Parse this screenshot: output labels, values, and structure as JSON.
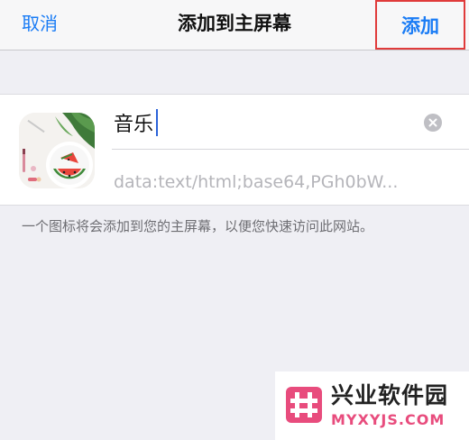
{
  "navbar": {
    "cancel_label": "取消",
    "title": "添加到主屏幕",
    "add_label": "添加"
  },
  "bookmark": {
    "icon_name": "watermelon-photo-icon",
    "name_value": "音乐",
    "url": "data:text/html;base64,PGh0bW..."
  },
  "hint": "一个图标将会添加到您的主屏幕，以便您快速访问此网站。",
  "watermark": {
    "name": "兴业软件园",
    "domain": "MYXYJS.COM"
  },
  "colors": {
    "accent": "#1a7cf5",
    "highlight": "#e03b3b",
    "background": "#efeff4",
    "watermark_pink": "#e84c7d"
  }
}
